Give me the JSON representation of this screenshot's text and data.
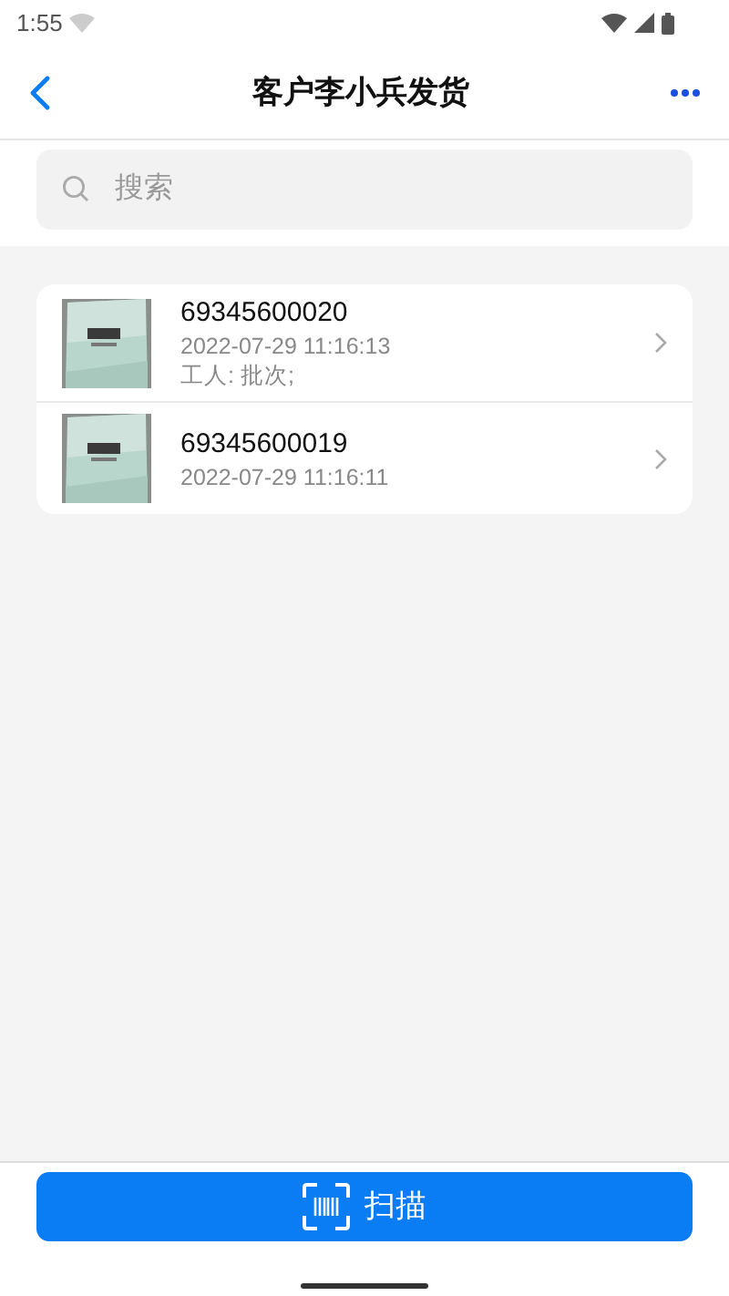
{
  "status_bar": {
    "time": "1:55"
  },
  "header": {
    "title": "客户李小兵发货"
  },
  "search": {
    "placeholder": "搜索"
  },
  "shipments": [
    {
      "code": "69345600020",
      "time": "2022-07-29 11:16:13",
      "note": "工人: 批次;"
    },
    {
      "code": "69345600019",
      "time": "2022-07-29 11:16:11"
    }
  ],
  "scan_button": {
    "label": "扫描"
  }
}
